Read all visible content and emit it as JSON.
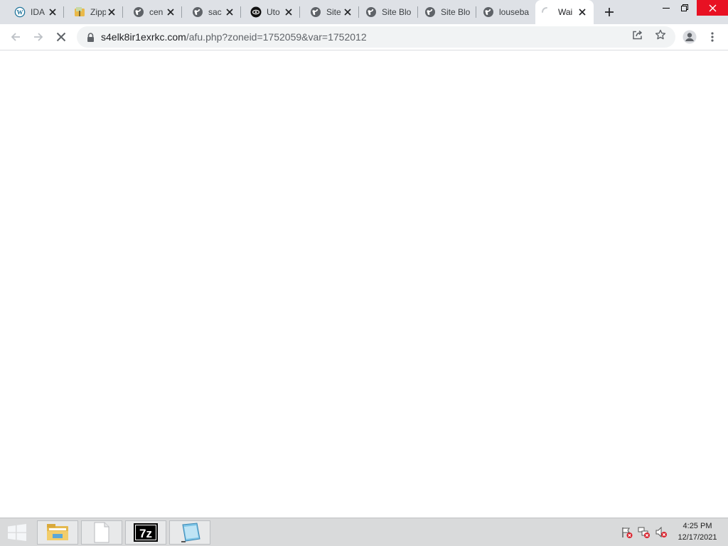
{
  "tabs": [
    {
      "title": "IDA",
      "icon": "wordpress-icon"
    },
    {
      "title": "Zipp",
      "icon": "zip-app-icon"
    },
    {
      "title": "cen",
      "icon": "globe-icon"
    },
    {
      "title": "sac",
      "icon": "globe-icon"
    },
    {
      "title": "Uto",
      "icon": "eye-circle-icon"
    },
    {
      "title": "Site",
      "icon": "globe-icon"
    },
    {
      "title": "Site Blo",
      "icon": "globe-icon"
    },
    {
      "title": "Site Blo",
      "icon": "globe-icon"
    },
    {
      "title": "louseba",
      "icon": "globe-icon"
    },
    {
      "title": "Wai",
      "icon": "loading-spinner-icon"
    }
  ],
  "address_bar": {
    "host": "s4elk8ir1exrkc.com",
    "path": "/afu.php?zoneid=1752059&var=1752012"
  },
  "taskbar": {
    "items": [
      "file-explorer-icon",
      "blank-document-icon",
      "7zip-icon",
      "notepad-icon"
    ],
    "tray": [
      "action-center-flag-icon",
      "network-icon",
      "volume-muted-icon"
    ],
    "time": "4:25 PM",
    "date": "12/17/2021"
  },
  "colors": {
    "tabstrip_bg": "#dee1e6",
    "omnibox_bg": "#f1f3f4",
    "close_red": "#e81123",
    "taskbar_bg": "#d9dadb"
  }
}
